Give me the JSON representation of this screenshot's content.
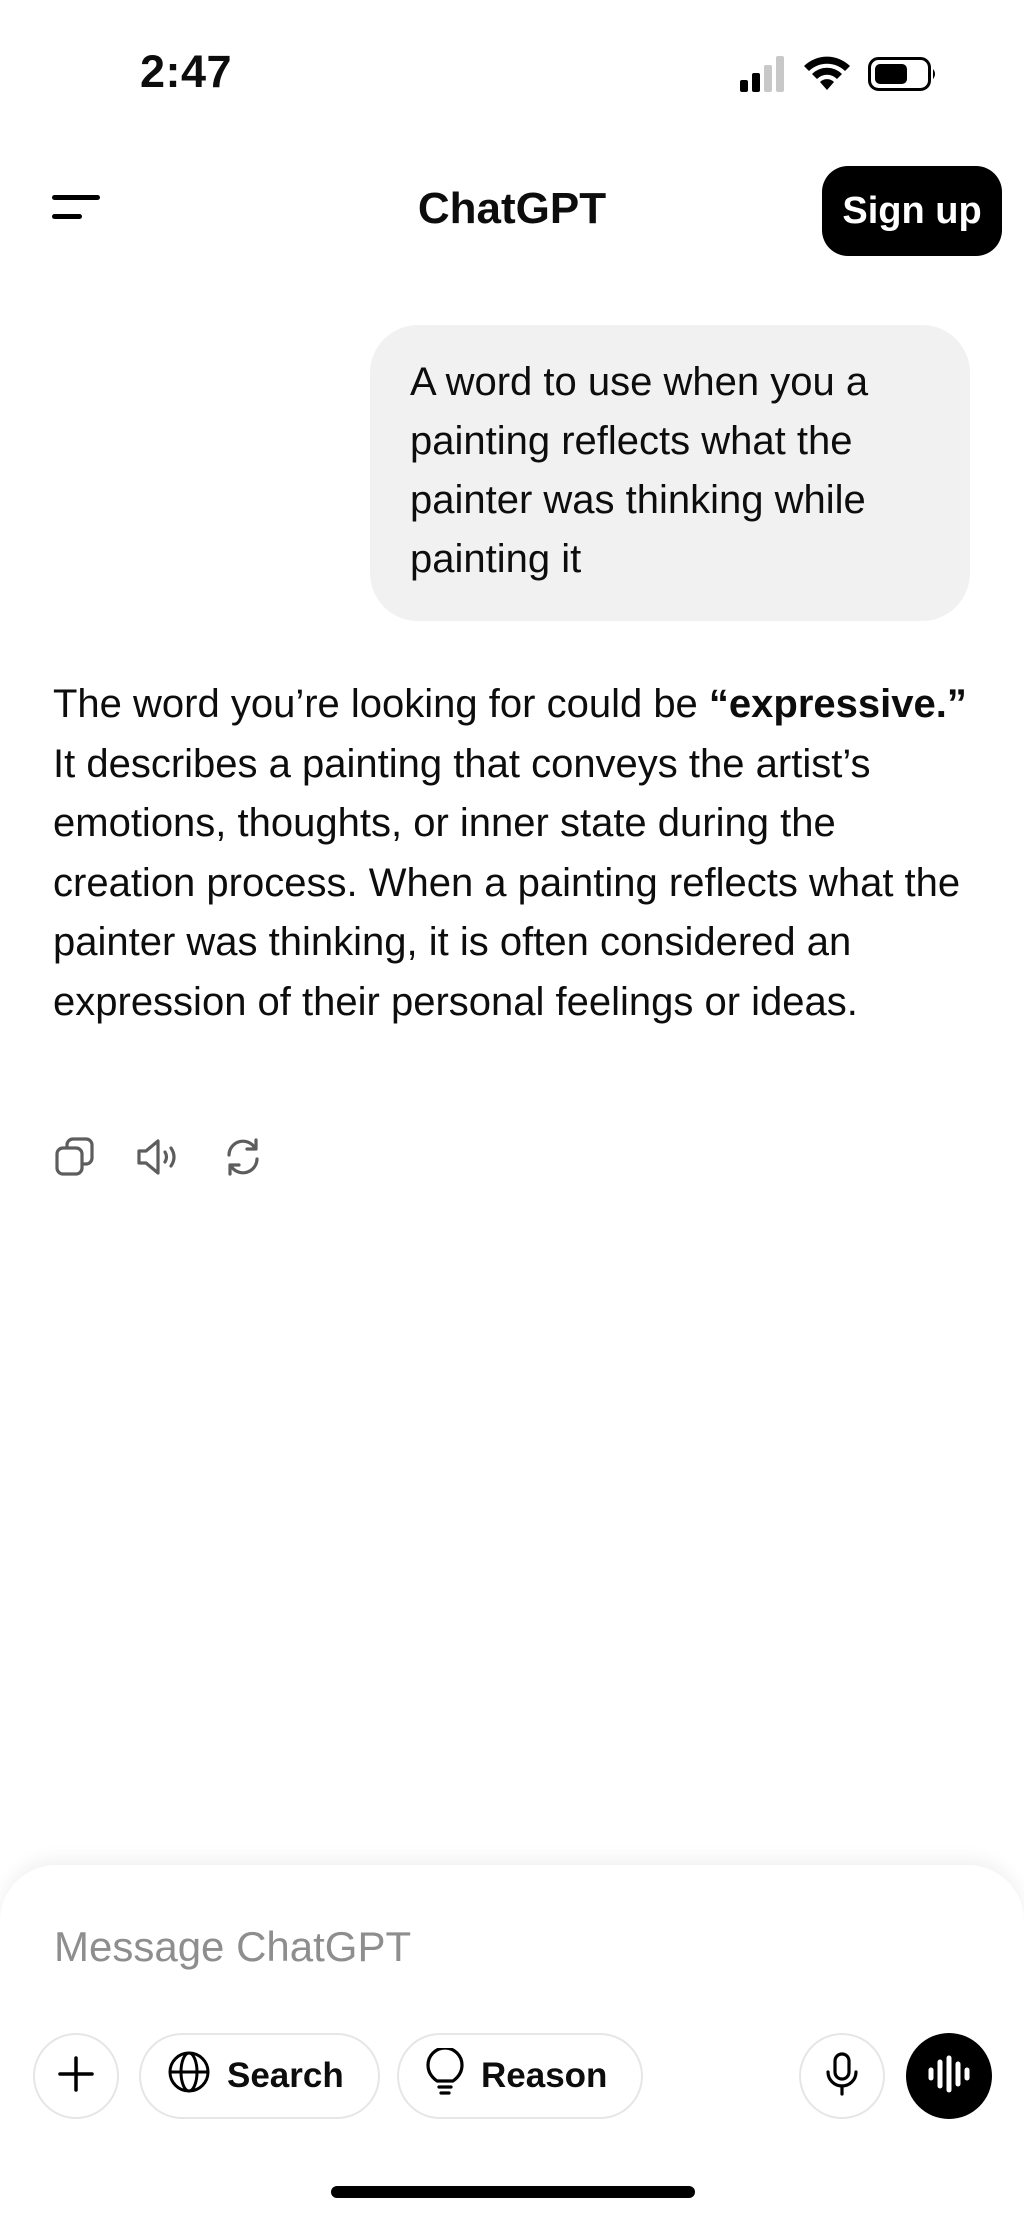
{
  "status_bar": {
    "time": "2:47"
  },
  "header": {
    "title": "ChatGPT",
    "signup_label": "Sign up"
  },
  "conversation": {
    "user_message": "A word to use when you a painting reflects what the painter was thinking while painting it",
    "assistant_intro": "The word you’re looking for could be ",
    "assistant_emphasis": "“expressive.”",
    "assistant_rest": " It describes a painting that conveys the artist’s emotions, thoughts, or inner state during the creation process. When a painting reflects what the painter was thinking, it is often considered an expression of their personal feelings or ideas."
  },
  "message_actions": {
    "icons": [
      "copy-icon",
      "read-aloud-icon",
      "regenerate-icon"
    ]
  },
  "composer": {
    "placeholder": "Message ChatGPT",
    "search_label": "Search",
    "reason_label": "Reason"
  },
  "colors": {
    "user_bubble": "#f1f1f1",
    "primary_button": "#000000",
    "placeholder_text": "#8e8e8e"
  }
}
